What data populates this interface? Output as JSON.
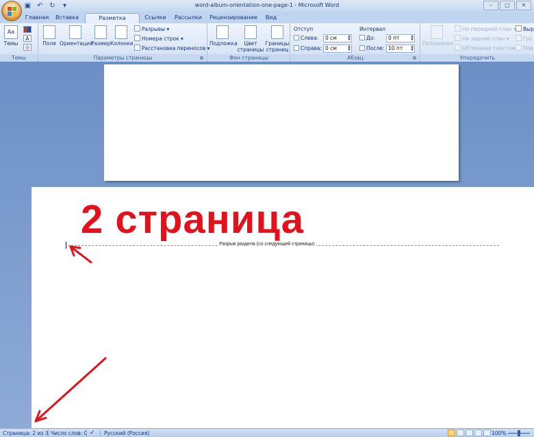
{
  "window": {
    "title": "word-album-orientation-one-page-1  -  Microsoft Word",
    "controls": [
      "–",
      "□",
      "✕"
    ]
  },
  "tabs": [
    {
      "label": "Главная"
    },
    {
      "label": "Вставка"
    },
    {
      "label": "Разметка страницы",
      "active": true
    },
    {
      "label": "Ссылки"
    },
    {
      "label": "Рассылки"
    },
    {
      "label": "Рецензирование"
    },
    {
      "label": "Вид"
    }
  ],
  "ribbon": {
    "themes": {
      "label": "Темы",
      "button": "Темы",
      "icon_glyph": "Aa"
    },
    "page_setup": {
      "label": "Параметры страницы",
      "margins": "Поля",
      "orientation": "Ориентация",
      "size": "Размер",
      "columns": "Колонки",
      "breaks": "Разрывы ▾",
      "line_numbers": "Номера строк ▾",
      "hyphenation": "Расстановка переносов ▾"
    },
    "page_background": {
      "label": "Фон страницы",
      "watermark": "Подложка",
      "page_color_1": "Цвет",
      "page_color_2": "страницы",
      "borders_1": "Границы",
      "borders_2": "страниц"
    },
    "paragraph": {
      "label": "Абзац",
      "indent_header": "Отступ",
      "spacing_header": "Интервал",
      "left_label": "Слева:",
      "left_value": "0 см",
      "right_label": "Справа:",
      "right_value": "0 см",
      "before_label": "До:",
      "before_value": "0 пт",
      "after_label": "После:",
      "after_value": "10 пт"
    },
    "arrange": {
      "label": "Упорядочить",
      "position": "Положение",
      "bring_front": "На передний план ▾",
      "send_back": "На задний план ▾",
      "text_wrap": "Обтекание текстом ▾",
      "align": "Выр",
      "group": "Гру",
      "rotate": "Пов"
    }
  },
  "document": {
    "section_break": "Разрыв раздела (со следующей страницы)",
    "annotation": "2 страница"
  },
  "statusbar": {
    "page": "Страница: 2 из 3",
    "words": "Число слов: 0",
    "language": "Русский (Россия)",
    "zoom": "100%"
  },
  "colors": {
    "annotation_red": "#e4101c",
    "workspace_blue": "#7b9bce"
  }
}
